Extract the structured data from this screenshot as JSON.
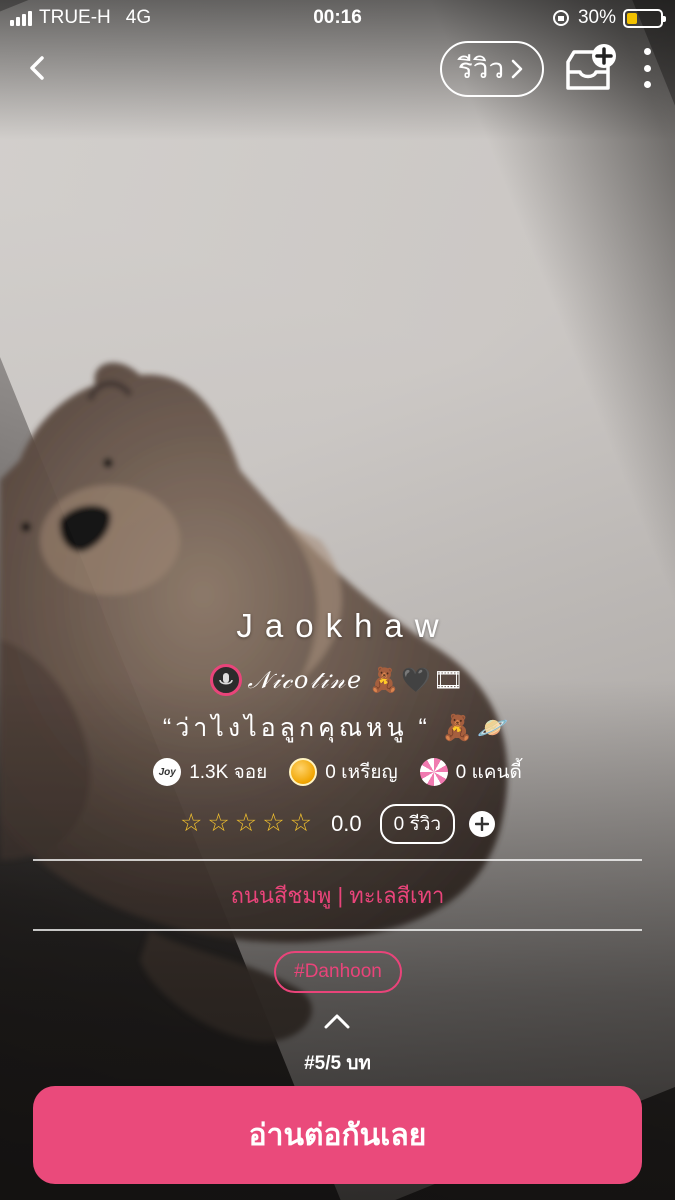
{
  "status_bar": {
    "carrier": "TRUE-H",
    "network": "4G",
    "time": "00:16",
    "battery": "30%",
    "battery_fraction": 0.3
  },
  "nav": {
    "review_label": "รีวิว",
    "back_icon": "chevron-left-icon",
    "add_icon": "add-to-shelf-icon",
    "more_icon": "more-vertical-icon"
  },
  "story": {
    "title": "Jaokhaw",
    "author": "𝒩𝒾𝒸𝑜𝓉𝒾𝓃𝑒",
    "author_emoji": "🧸🖤🎞",
    "tagline": "“ว่าไงไอลูกคุณหนู “",
    "tagline_emoji": "🧸🪐"
  },
  "stats": {
    "joy": "1.3K จอย",
    "coins": "0 เหรียญ",
    "candy": "0 แคนดี้"
  },
  "rating": {
    "value": "0.0",
    "stars_filled": 0,
    "stars_total": 5,
    "review_count": "0 รีวิว"
  },
  "category": "ถนนสีชมพู | ทะเลสีเทา",
  "hashtag": "#Danhoon",
  "chapters": "#5/5 บท",
  "read_button": "อ่านต่อกันเลย",
  "colors": {
    "accent": "#ea4a7b",
    "star": "#f2c12e"
  }
}
